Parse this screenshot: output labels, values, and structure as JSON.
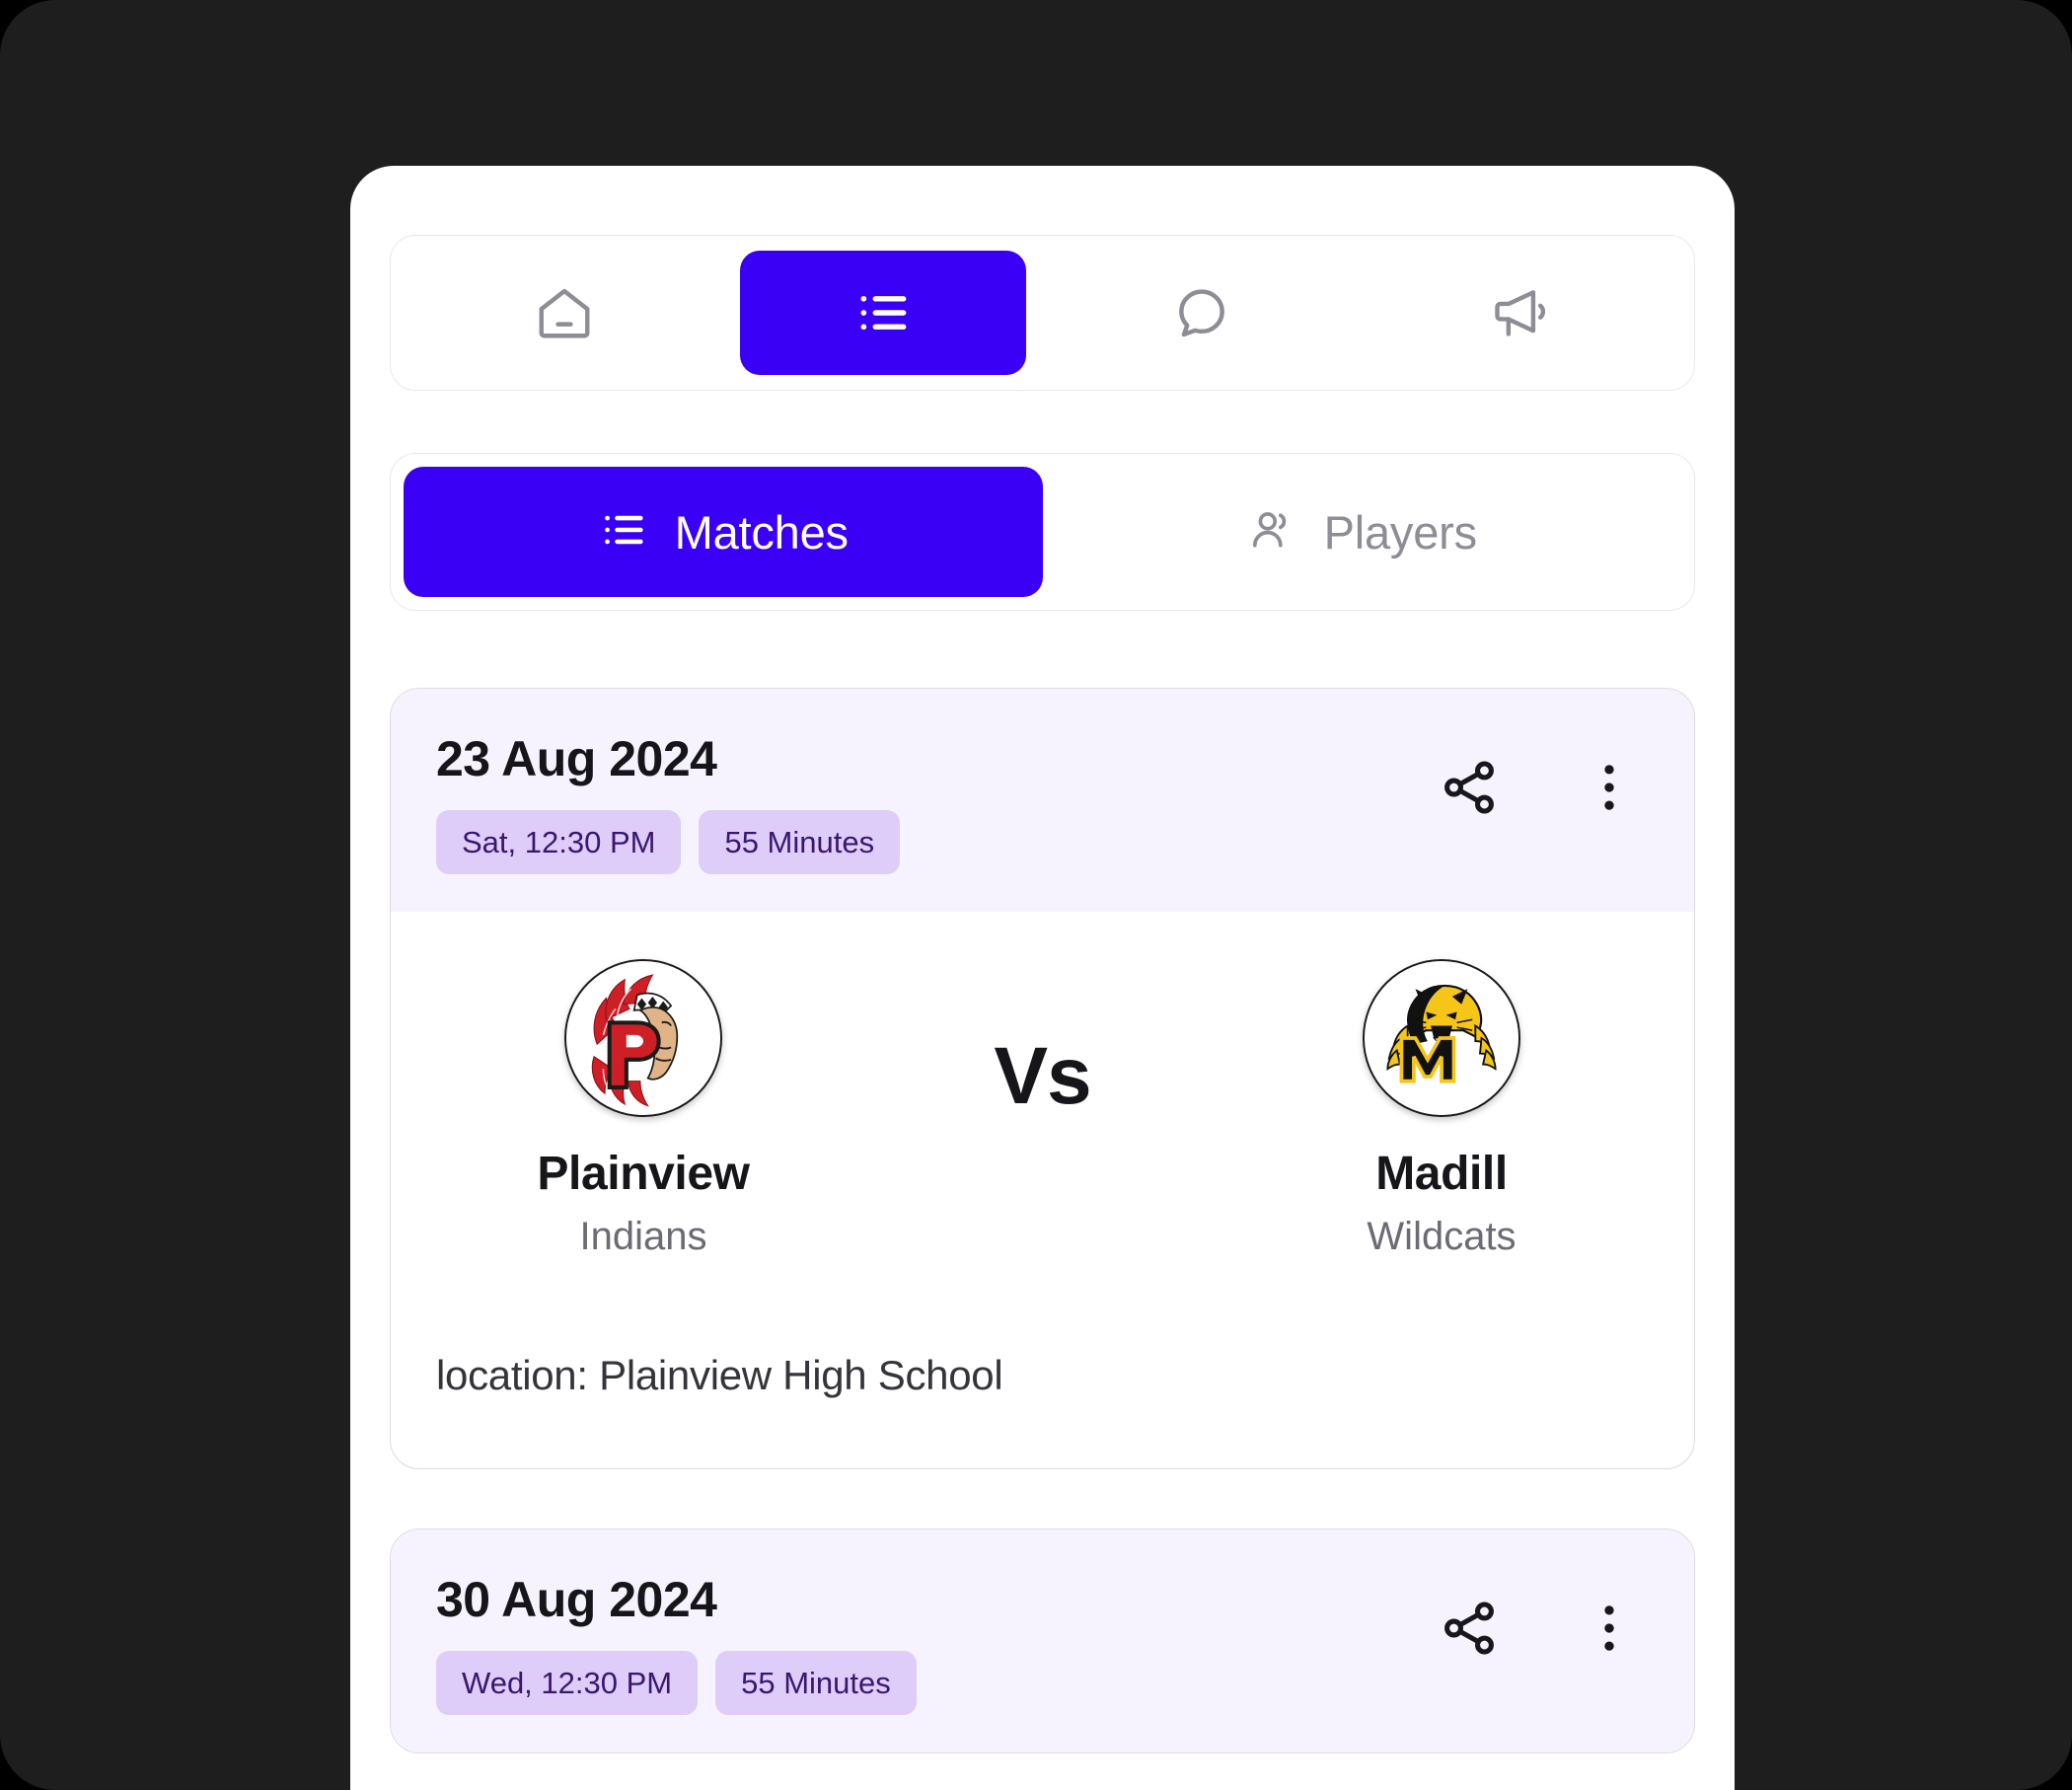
{
  "theme": {
    "accent": "#3a00f5",
    "badge_bg": "#ddcdf8",
    "badge_text": "#3a1670",
    "card_header_bg": "#f6f3fe",
    "page_bg": "#1e1e1e",
    "panel_bg": "#ffffff",
    "muted_text": "#8d8d96"
  },
  "top_nav": {
    "items": [
      {
        "icon": "home-icon",
        "active": false
      },
      {
        "icon": "list-icon",
        "active": true
      },
      {
        "icon": "chat-bubble-icon",
        "active": false
      },
      {
        "icon": "megaphone-icon",
        "active": false
      }
    ]
  },
  "segmented": {
    "tabs": [
      {
        "label": "Matches",
        "icon": "list-icon",
        "active": true
      },
      {
        "label": "Players",
        "icon": "users-icon",
        "active": false
      }
    ]
  },
  "matches": [
    {
      "date": "23 Aug 2024",
      "badges": [
        "Sat, 12:30 PM",
        "55 Minutes"
      ],
      "share_icon": "share-icon",
      "menu_icon": "more-vertical-icon",
      "home_team": {
        "name": "Plainview",
        "mascot": "Indians",
        "logo": "plainview-indians-logo"
      },
      "away_team": {
        "name": "Madill",
        "mascot": "Wildcats",
        "logo": "madill-wildcats-logo"
      },
      "versus": "Vs",
      "location": "location: Plainview High School"
    },
    {
      "date": "30 Aug 2024",
      "badges": [
        "Wed, 12:30 PM",
        "55 Minutes"
      ],
      "share_icon": "share-icon",
      "menu_icon": "more-vertical-icon"
    }
  ]
}
